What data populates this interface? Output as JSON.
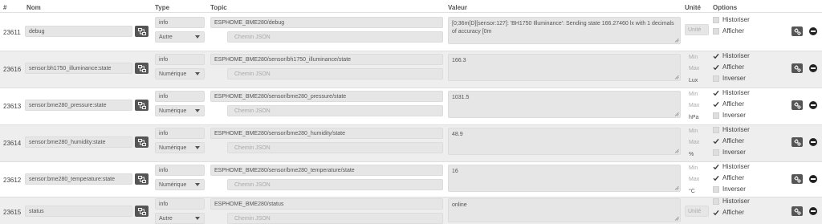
{
  "header": {
    "id": "#",
    "name": "Nom",
    "type": "Type",
    "topic": "Topic",
    "value": "Valeur",
    "unit": "Unité",
    "options": "Options"
  },
  "common": {
    "subtype_info": "info",
    "json_placeholder": "Chemin JSON",
    "unit_placeholder": "Unité",
    "min_label": "Min",
    "max_label": "Max",
    "opt_historize": "Historiser",
    "opt_display": "Afficher",
    "opt_invert": "Inverser"
  },
  "rows": [
    {
      "id": "23611",
      "name": "debug",
      "subtype": "Autre",
      "topic": "ESPHOME_BME280/debug",
      "value": "[0;36m[D][sensor:127]: 'BH1750 Illuminance': Sending state 166.27460 lx with 1 decimals of accuracy [0m",
      "unit": "",
      "historize": false,
      "display": false,
      "invert": null
    },
    {
      "id": "23616",
      "name": "sensor:bh1750_illuminance:state",
      "subtype": "Numérique",
      "topic": "ESPHOME_BME280/sensor/bh1750_illuminance/state",
      "value": "166.3",
      "unit": "Lux",
      "historize": true,
      "display": true,
      "invert": false
    },
    {
      "id": "23613",
      "name": "sensor:bme280_pressure:state",
      "subtype": "Numérique",
      "topic": "ESPHOME_BME280/sensor/bme280_pressure/state",
      "value": "1031.5",
      "unit": "hPa",
      "historize": true,
      "display": true,
      "invert": false
    },
    {
      "id": "23614",
      "name": "sensor:bme280_humidity:state",
      "subtype": "Numérique",
      "topic": "ESPHOME_BME280/sensor/bme280_humidity/state",
      "value": "48.9",
      "unit": "%",
      "historize": false,
      "display": true,
      "invert": false
    },
    {
      "id": "23612",
      "name": "sensor:bme280_temperature:state",
      "subtype": "Numérique",
      "topic": "ESPHOME_BME280/sensor/bme280_temperature/state",
      "value": "16",
      "unit": "°C",
      "historize": true,
      "display": true,
      "invert": false
    },
    {
      "id": "23615",
      "name": "status",
      "subtype": "Autre",
      "topic": "ESPHOME_BME280/status",
      "value": "online",
      "unit": "",
      "historize": false,
      "display": true,
      "invert": null
    }
  ],
  "colors": {
    "row_alt": "#eeeeee",
    "button": "#555555",
    "field": "#e6e6e6"
  }
}
